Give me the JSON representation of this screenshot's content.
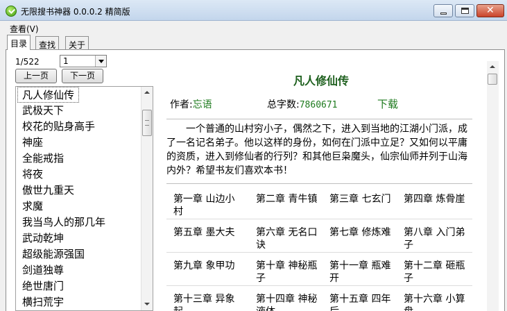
{
  "window": {
    "title": "无限搜书神器 0.0.0.2 精简版"
  },
  "menu": {
    "view": "查看(V)"
  },
  "tabs": [
    "目录",
    "查找",
    "关于"
  ],
  "pager": {
    "counter": "1/522",
    "selected_page": "1",
    "prev_label": "上一页",
    "next_label": "下一页"
  },
  "books": [
    "凡人修仙传",
    "武极天下",
    "校花的贴身高手",
    "神座",
    "全能戒指",
    "将夜",
    "傲世九重天",
    "求魔",
    "我当鸟人的那几年",
    "武动乾坤",
    "超级能源强国",
    "剑道独尊",
    "绝世唐门",
    "横扫荒宇"
  ],
  "detail": {
    "title": "凡人修仙传",
    "author_label": "作者:",
    "author": "忘语",
    "wordcount_label": "总字数:",
    "wordcount": "7860671",
    "download_label": "下载",
    "intro": "一个普通的山村穷小子，偶然之下，进入到当地的江湖小门派，成了一名记名弟子。他以这样的身份，如何在门派中立足？又如何以平庸的资质，进入到修仙者的行列？和其他巨枭魔头，仙宗仙师并列于山海内外？希望书友们喜欢本书！",
    "chapters": [
      "第一章 山边小村",
      "第二章 青牛镇",
      "第三章 七玄门",
      "第四章 炼骨崖",
      "第五章 墨大夫",
      "第六章 无名口诀",
      "第七章 修炼难",
      "第八章 入门弟子",
      "第九章 象甲功",
      "第十章 神秘瓶子",
      "第十一章 瓶难开",
      "第十二章 砸瓶子",
      "第十三章 异象起",
      "第十四章 神秘液体",
      "第十五章 四年后",
      "第十六章 小算盘"
    ]
  }
}
